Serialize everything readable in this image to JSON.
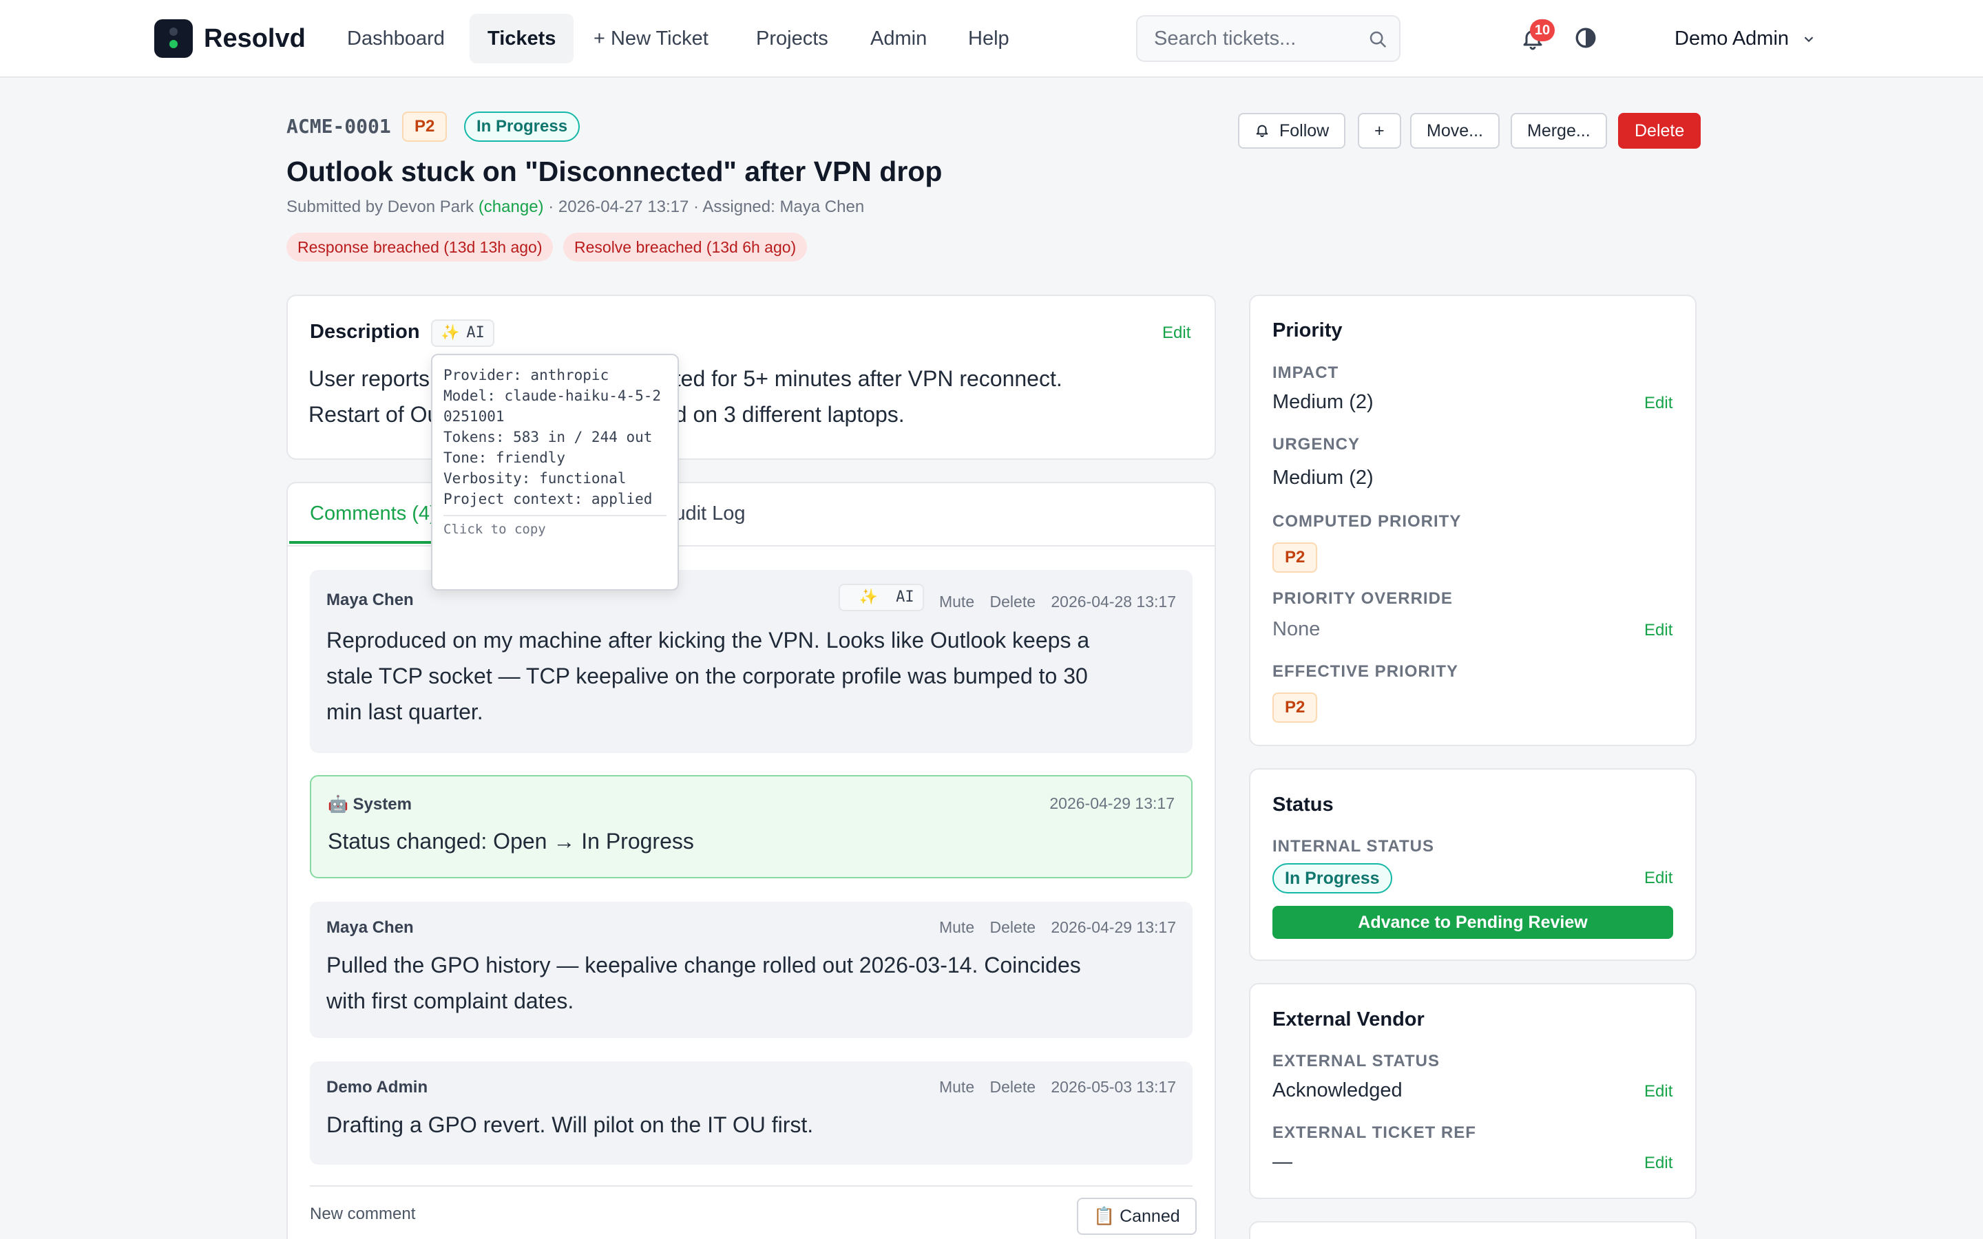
{
  "nav": {
    "brand": "Resolvd",
    "items": [
      {
        "label": "Dashboard",
        "active": false
      },
      {
        "label": "Tickets",
        "active": true
      },
      {
        "label": "+ New Ticket",
        "active": false
      },
      {
        "label": "Projects",
        "active": false
      },
      {
        "label": "Admin",
        "active": false
      },
      {
        "label": "Help",
        "active": false
      }
    ],
    "search_placeholder": "Search tickets...",
    "notification_count": "10",
    "user": "Demo Admin"
  },
  "ticket": {
    "key": "ACME-0001",
    "priority": "P2",
    "status": "In Progress",
    "title": "Outlook stuck on \"Disconnected\" after VPN drop",
    "submitted_prefix": "Submitted by Devon Park",
    "change_link": "(change)",
    "submitted_suffix": "· 2026-04-27 13:17 · Assigned: Maya Chen",
    "breaches": [
      "Response breached (13d 13h ago)",
      "Resolve breached (13d 6h ago)"
    ]
  },
  "actions": {
    "follow": "Follow",
    "add": "+",
    "move": "Move...",
    "merge": "Merge...",
    "delete": "Delete"
  },
  "description": {
    "heading": "Description",
    "ai_label": "AI",
    "edit": "Edit",
    "line1": "User reports Outlook stays disconnected for 5+ minutes after VPN reconnect.",
    "line2": "Restart of Outlook fixes it. Reproduced on 3 different laptops."
  },
  "tooltip": {
    "lines": [
      "Provider: anthropic",
      "Model: claude-haiku-4-5-20251001",
      "Tokens: 583 in / 244 out",
      "Tone: friendly",
      "Verbosity: functional",
      "Project context: applied"
    ],
    "copy_hint": "Click to copy"
  },
  "tabs": {
    "comments": "Comments (4)",
    "audit": "Audit Log"
  },
  "comments": [
    {
      "author": "Maya Chen",
      "ai": "AI",
      "mute": "Mute",
      "delete": "Delete",
      "time": "2026-04-28 13:17",
      "line1": "Reproduced on my machine after kicking the VPN. Looks like Outlook keeps a",
      "line2": "stale TCP socket — TCP keepalive on the corporate profile was bumped to 30",
      "line3": "min last quarter."
    },
    {
      "author": "🤖 System",
      "time": "2026-04-29 13:17",
      "line1": "Status changed: Open → In Progress"
    },
    {
      "author": "Maya Chen",
      "mute": "Mute",
      "delete": "Delete",
      "time": "2026-04-29 13:17",
      "line1": "Pulled the GPO history — keepalive change rolled out 2026-03-14. Coincides",
      "line2": "with first complaint dates."
    },
    {
      "author": "Demo Admin",
      "mute": "Mute",
      "delete": "Delete",
      "time": "2026-05-03 13:17",
      "line1": "Drafting a GPO revert. Will pilot on the IT OU first."
    }
  ],
  "new_comment": {
    "label": "New comment",
    "canned": "📋 Canned"
  },
  "priority_card": {
    "heading": "Priority",
    "impact_label": "IMPACT",
    "impact_value": "Medium (2)",
    "urgency_label": "URGENCY",
    "urgency_value": "Medium (2)",
    "computed_label": "COMPUTED PRIORITY",
    "computed_value": "P2",
    "override_label": "PRIORITY OVERRIDE",
    "override_value": "None",
    "effective_label": "EFFECTIVE PRIORITY",
    "effective_value": "P2",
    "edit": "Edit"
  },
  "status_card": {
    "heading": "Status",
    "internal_label": "INTERNAL STATUS",
    "internal_value": "In Progress",
    "edit": "Edit",
    "advance": "Advance to Pending Review"
  },
  "vendor_card": {
    "heading": "External Vendor",
    "ext_status_label": "EXTERNAL STATUS",
    "ext_status_value": "Acknowledged",
    "ext_ref_label": "EXTERNAL TICKET REF",
    "ext_ref_value": "—",
    "edit": "Edit"
  }
}
